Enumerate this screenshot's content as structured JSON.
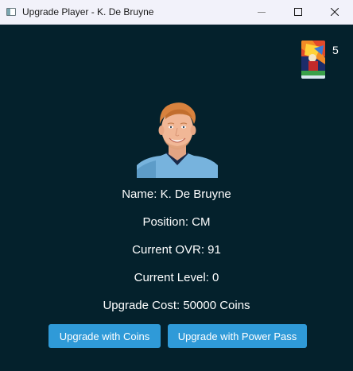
{
  "window": {
    "title": "Upgrade Player - K. De Bruyne"
  },
  "header": {
    "card_count": "5"
  },
  "player": {
    "name": "Name: K. De Bruyne",
    "position": "Position: CM",
    "current_ovr": "Current OVR: 91",
    "current_level": "Current Level: 0",
    "upgrade_cost": "Upgrade Cost: 50000 Coins"
  },
  "actions": {
    "upgrade_coins_label": "Upgrade with Coins",
    "upgrade_power_pass_label": "Upgrade with Power Pass"
  },
  "colors": {
    "background": "#04212c",
    "button": "#2f9ad8",
    "text": "#ffffff"
  }
}
